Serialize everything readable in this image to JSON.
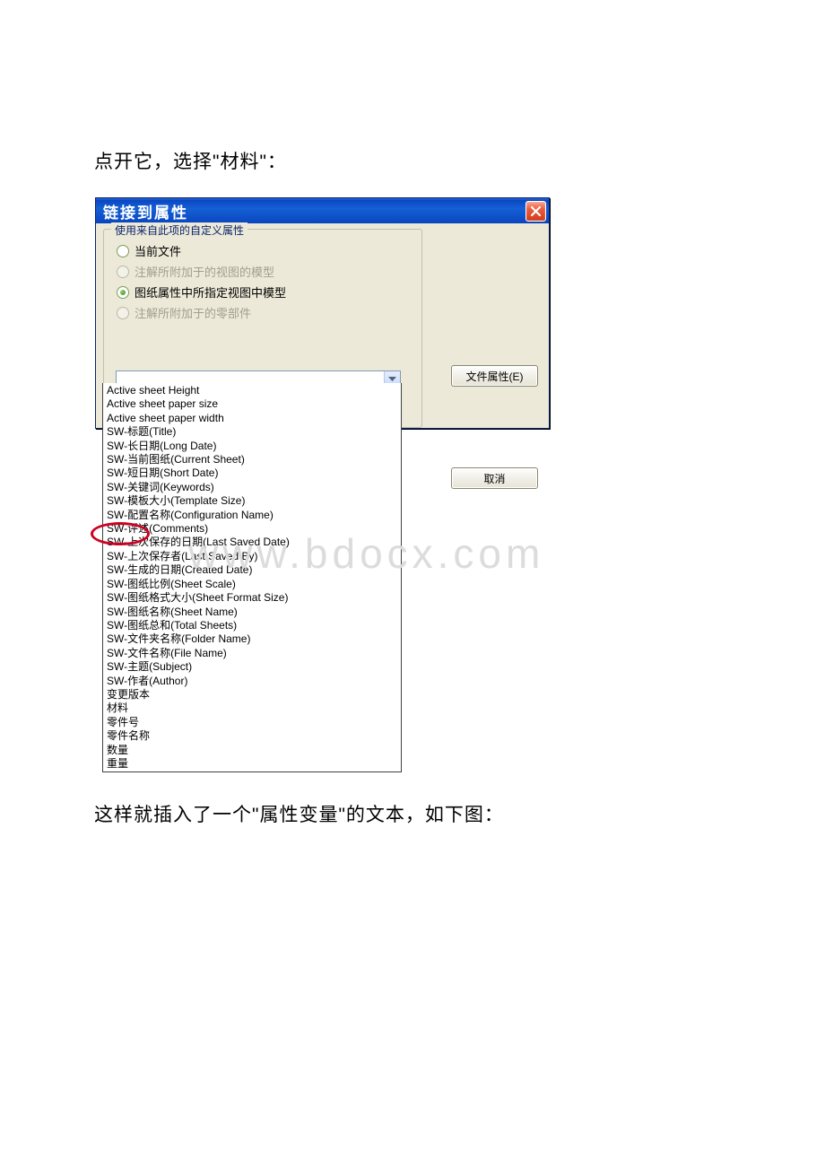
{
  "doc": {
    "intro_text": "点开它，选择\"材料\"：",
    "outro_text": "这样就插入了一个\"属性变量\"的文本，如下图：",
    "watermark": "www.bdocx.com"
  },
  "dialog": {
    "title": "链接到属性",
    "group_legend": "使用来自此项的自定义属性",
    "radios": {
      "r0": "当前文件",
      "r1": "注解所附加于的视图的模型",
      "r2": "图纸属性中所指定视图中模型",
      "r3": "注解所附加于的零部件"
    },
    "buttons": {
      "file_props": "文件属性(E)",
      "cancel": "取消"
    },
    "list": [
      "Active sheet Height",
      "Active sheet paper size",
      "Active sheet paper width",
      "SW-标题(Title)",
      "SW-长日期(Long Date)",
      "SW-当前图纸(Current Sheet)",
      "SW-短日期(Short Date)",
      "SW-关键词(Keywords)",
      "SW-模板大小(Template Size)",
      "SW-配置名称(Configuration Name)",
      "SW-评述(Comments)",
      "SW-上次保存的日期(Last Saved Date)",
      "SW-上次保存者(Last Saved By)",
      "SW-生成的日期(Created Date)",
      "SW-图纸比例(Sheet Scale)",
      "SW-图纸格式大小(Sheet Format Size)",
      "SW-图纸名称(Sheet Name)",
      "SW-图纸总和(Total Sheets)",
      "SW-文件夹名称(Folder Name)",
      "SW-文件名称(File Name)",
      "SW-主题(Subject)",
      "SW-作者(Author)",
      "变更版本",
      "材料",
      "零件号",
      "零件名称",
      "数量",
      "重量"
    ]
  }
}
